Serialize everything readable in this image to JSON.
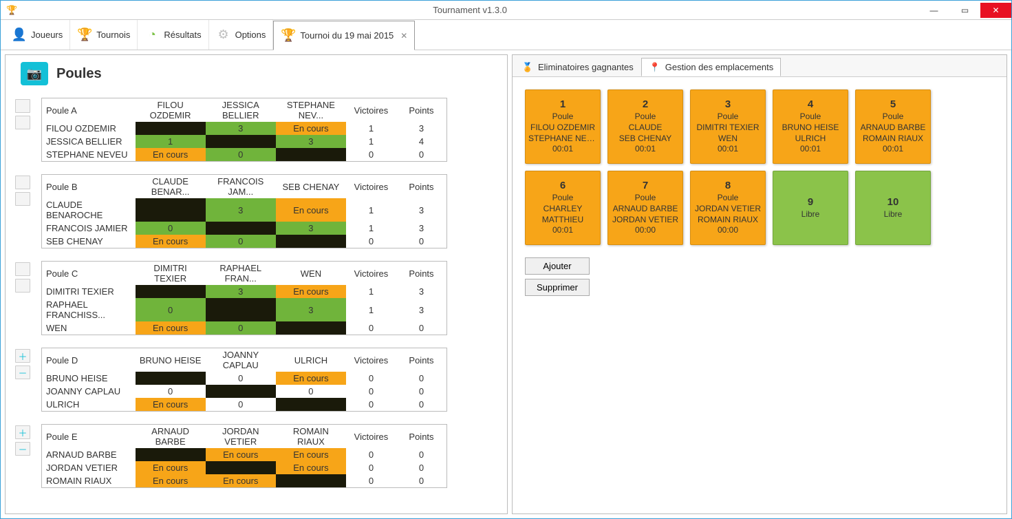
{
  "window": {
    "title": "Tournament v1.3.0"
  },
  "toolbar": {
    "tabs": [
      {
        "label": "Joueurs",
        "icon": "person-icon",
        "color": "#4a55c9"
      },
      {
        "label": "Tournois",
        "icon": "trophy-icon",
        "color": "#d83a3a"
      },
      {
        "label": "Résultats",
        "icon": "pie-icon",
        "color": "#7cc247"
      },
      {
        "label": "Options",
        "icon": "gear-icon",
        "color": "#bfbfbf"
      }
    ],
    "active_tab": {
      "label": "Tournoi du 19 mai 2015",
      "icon": "trophy-icon",
      "color": "#d83a3a"
    }
  },
  "left": {
    "title": "Poules",
    "cols_v": "Victoires",
    "cols_p": "Points",
    "en_cours": "En cours",
    "poules": [
      {
        "name": "Poule A",
        "side": "empty",
        "players": [
          "FILOU OZDEMIR",
          "JESSICA BELLIER",
          "STEPHANE NEVEU"
        ],
        "headers": [
          "FILOU OZDEMIR",
          "JESSICA BELLIER",
          "STEPHANE NEV..."
        ],
        "rows": [
          {
            "cells": [
              {
                "t": "black"
              },
              {
                "t": "green",
                "v": "3"
              },
              {
                "t": "orange",
                "v": "En cours"
              }
            ],
            "v": "1",
            "p": "3"
          },
          {
            "cells": [
              {
                "t": "green",
                "v": "1"
              },
              {
                "t": "black"
              },
              {
                "t": "green",
                "v": "3"
              }
            ],
            "v": "1",
            "p": "4"
          },
          {
            "cells": [
              {
                "t": "orange",
                "v": "En cours"
              },
              {
                "t": "green",
                "v": "0"
              },
              {
                "t": "black"
              }
            ],
            "v": "0",
            "p": "0"
          }
        ]
      },
      {
        "name": "Poule B",
        "side": "empty",
        "players": [
          "CLAUDE BENAROCHE",
          "FRANCOIS JAMIER",
          "SEB CHENAY"
        ],
        "headers": [
          "CLAUDE BENAR...",
          "FRANCOIS JAM...",
          "SEB CHENAY"
        ],
        "rows": [
          {
            "cells": [
              {
                "t": "black"
              },
              {
                "t": "green",
                "v": "3"
              },
              {
                "t": "orange",
                "v": "En cours"
              }
            ],
            "v": "1",
            "p": "3"
          },
          {
            "cells": [
              {
                "t": "green",
                "v": "0"
              },
              {
                "t": "black"
              },
              {
                "t": "green",
                "v": "3"
              }
            ],
            "v": "1",
            "p": "3"
          },
          {
            "cells": [
              {
                "t": "orange",
                "v": "En cours"
              },
              {
                "t": "green",
                "v": "0"
              },
              {
                "t": "black"
              }
            ],
            "v": "0",
            "p": "0"
          }
        ]
      },
      {
        "name": "Poule C",
        "side": "empty",
        "players": [
          "DIMITRI TEXIER",
          "RAPHAEL FRANCHISS...",
          "WEN"
        ],
        "headers": [
          "DIMITRI TEXIER",
          "RAPHAEL FRAN...",
          "WEN"
        ],
        "rows": [
          {
            "cells": [
              {
                "t": "black"
              },
              {
                "t": "green",
                "v": "3"
              },
              {
                "t": "orange",
                "v": "En cours"
              }
            ],
            "v": "1",
            "p": "3"
          },
          {
            "cells": [
              {
                "t": "green",
                "v": "0"
              },
              {
                "t": "black"
              },
              {
                "t": "green",
                "v": "3"
              }
            ],
            "v": "1",
            "p": "3"
          },
          {
            "cells": [
              {
                "t": "orange",
                "v": "En cours"
              },
              {
                "t": "green",
                "v": "0"
              },
              {
                "t": "black"
              }
            ],
            "v": "0",
            "p": "0"
          }
        ]
      },
      {
        "name": "Poule D",
        "side": "plusminus",
        "players": [
          "BRUNO HEISE",
          "JOANNY CAPLAU",
          "ULRICH"
        ],
        "headers": [
          "BRUNO HEISE",
          "JOANNY CAPLAU",
          "ULRICH"
        ],
        "rows": [
          {
            "cells": [
              {
                "t": "black"
              },
              {
                "t": "white",
                "v": "0"
              },
              {
                "t": "orange",
                "v": "En cours"
              }
            ],
            "v": "0",
            "p": "0"
          },
          {
            "cells": [
              {
                "t": "white",
                "v": "0"
              },
              {
                "t": "black"
              },
              {
                "t": "white",
                "v": "0"
              }
            ],
            "v": "0",
            "p": "0"
          },
          {
            "cells": [
              {
                "t": "orange",
                "v": "En cours"
              },
              {
                "t": "white",
                "v": "0"
              },
              {
                "t": "black"
              }
            ],
            "v": "0",
            "p": "0"
          }
        ]
      },
      {
        "name": "Poule E",
        "side": "plusminus",
        "players": [
          "ARNAUD BARBE",
          "JORDAN VETIER",
          "ROMAIN RIAUX"
        ],
        "headers": [
          "ARNAUD BARBE",
          "JORDAN VETIER",
          "ROMAIN RIAUX"
        ],
        "rows": [
          {
            "cells": [
              {
                "t": "black"
              },
              {
                "t": "orange",
                "v": "En cours"
              },
              {
                "t": "orange",
                "v": "En cours"
              }
            ],
            "v": "0",
            "p": "0"
          },
          {
            "cells": [
              {
                "t": "orange",
                "v": "En cours"
              },
              {
                "t": "black"
              },
              {
                "t": "orange",
                "v": "En cours"
              }
            ],
            "v": "0",
            "p": "0"
          },
          {
            "cells": [
              {
                "t": "orange",
                "v": "En cours"
              },
              {
                "t": "orange",
                "v": "En cours"
              },
              {
                "t": "black"
              }
            ],
            "v": "0",
            "p": "0"
          }
        ]
      }
    ]
  },
  "right": {
    "tabs": [
      {
        "label": "Eliminatoires gagnantes",
        "icon": "medal-icon",
        "color": "#f7a518"
      },
      {
        "label": "Gestion des emplacements",
        "icon": "pin-icon",
        "color": "#f7a518"
      }
    ],
    "active_index": 1,
    "slot_label": "Poule",
    "free_label": "Libre",
    "slots": [
      {
        "n": "1",
        "state": "busy",
        "p1": "FILOU OZDEMIR",
        "p2": "STEPHANE NEVEU",
        "t": "00:01"
      },
      {
        "n": "2",
        "state": "busy",
        "p1": "CLAUDE",
        "p2": "SEB CHENAY",
        "t": "00:01"
      },
      {
        "n": "3",
        "state": "busy",
        "p1": "DIMITRI TEXIER",
        "p2": "WEN",
        "t": "00:01"
      },
      {
        "n": "4",
        "state": "busy",
        "p1": "BRUNO HEISE",
        "p2": "ULRICH",
        "t": "00:01"
      },
      {
        "n": "5",
        "state": "busy",
        "p1": "ARNAUD BARBE",
        "p2": "ROMAIN RIAUX",
        "t": "00:01"
      },
      {
        "n": "6",
        "state": "busy",
        "p1": "CHARLEY",
        "p2": "MATTHIEU",
        "t": "00:01"
      },
      {
        "n": "7",
        "state": "busy",
        "p1": "ARNAUD BARBE",
        "p2": "JORDAN VETIER",
        "t": "00:00"
      },
      {
        "n": "8",
        "state": "busy",
        "p1": "JORDAN VETIER",
        "p2": "ROMAIN RIAUX",
        "t": "00:00"
      },
      {
        "n": "9",
        "state": "free"
      },
      {
        "n": "10",
        "state": "free"
      }
    ],
    "buttons": {
      "add": "Ajouter",
      "del": "Supprimer"
    }
  }
}
